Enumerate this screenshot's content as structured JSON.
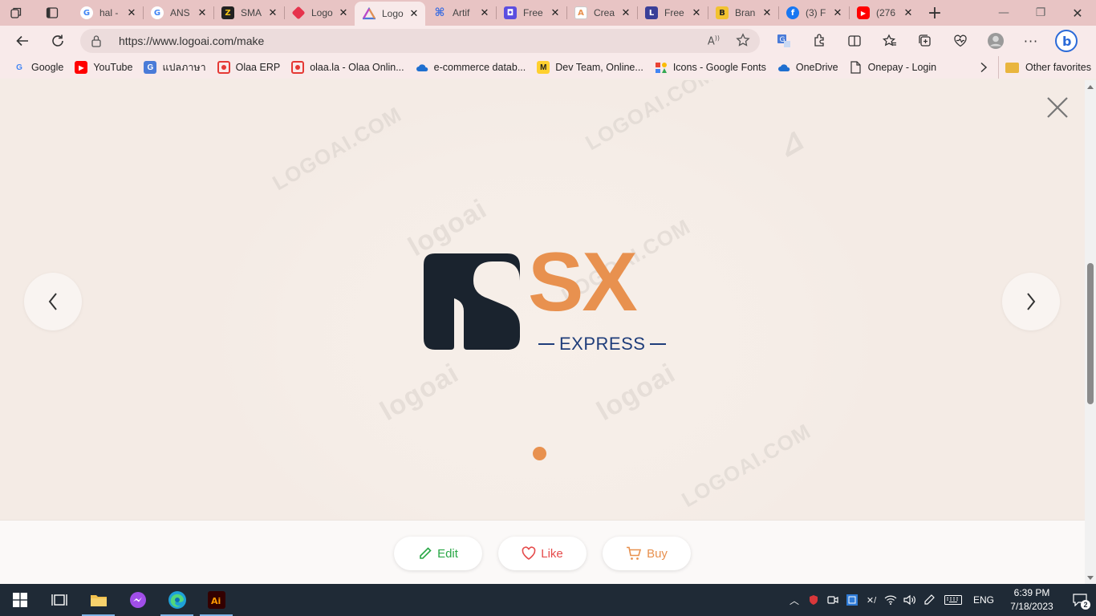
{
  "browser": {
    "tabs": [
      {
        "title": "hal -",
        "favicon": "google-icon",
        "active": false
      },
      {
        "title": "ANS",
        "favicon": "google-icon",
        "active": false
      },
      {
        "title": "SMA",
        "favicon": "sma-icon",
        "active": false
      },
      {
        "title": "Logo",
        "favicon": "logo-diamond-icon",
        "active": false
      },
      {
        "title": "Logo",
        "favicon": "logoai-icon",
        "active": true
      },
      {
        "title": "Artif",
        "favicon": "artifact-icon",
        "active": false
      },
      {
        "title": "Free",
        "favicon": "free-blue-icon",
        "active": false
      },
      {
        "title": "Crea",
        "favicon": "create-icon",
        "active": false
      },
      {
        "title": "Free",
        "favicon": "letter-l-icon",
        "active": false
      },
      {
        "title": "Bran",
        "favicon": "letter-b-icon",
        "active": false
      },
      {
        "title": "(3) F",
        "favicon": "facebook-icon",
        "active": false
      },
      {
        "title": "(276",
        "favicon": "youtube-icon",
        "active": false
      }
    ],
    "url": "https://www.logoai.com/make",
    "bookmarks": [
      {
        "label": "Google",
        "icon": "google-icon"
      },
      {
        "label": "YouTube",
        "icon": "youtube-icon"
      },
      {
        "label": "แปลภาษา",
        "icon": "translate-icon"
      },
      {
        "label": "Olaa ERP",
        "icon": "olaa-icon"
      },
      {
        "label": "olaa.la - Olaa Onlin...",
        "icon": "olaa-icon"
      },
      {
        "label": "e-commerce datab...",
        "icon": "onedrive-icon"
      },
      {
        "label": "Dev Team, Online...",
        "icon": "miro-icon"
      },
      {
        "label": "Icons - Google Fonts",
        "icon": "google-fonts-icon"
      },
      {
        "label": "OneDrive",
        "icon": "onedrive-icon"
      },
      {
        "label": "Onepay - Login",
        "icon": "page-icon"
      }
    ],
    "other_favorites": "Other favorites"
  },
  "logo": {
    "brand": "SX",
    "tagline": "EXPRESS",
    "colors": {
      "mark": "#1a232e",
      "brand": "#e8914f",
      "tagline": "#1f3d7a"
    }
  },
  "watermark_text": [
    "LOGOAI.COM",
    "logoai"
  ],
  "actions": {
    "edit_label": "Edit",
    "like_label": "Like",
    "buy_label": "Buy"
  },
  "taskbar": {
    "lang": "ENG",
    "time": "6:39 PM",
    "date": "7/18/2023",
    "notifications": "2"
  }
}
